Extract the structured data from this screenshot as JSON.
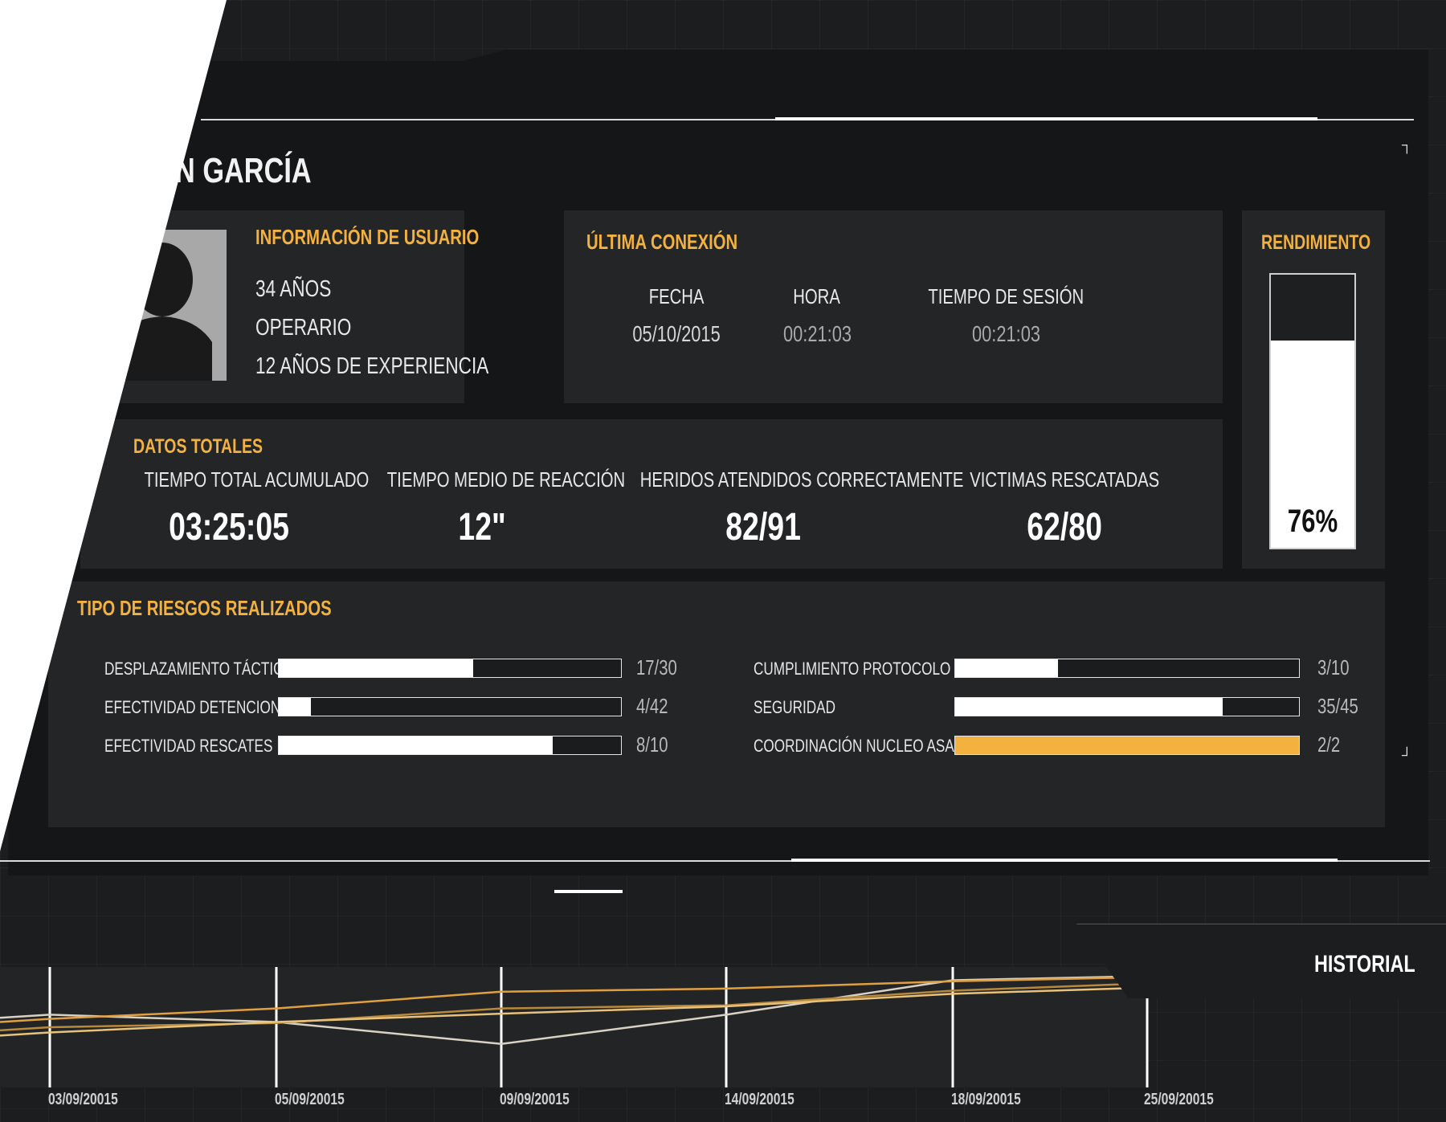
{
  "header": {
    "name": "N GARCÍA"
  },
  "user_info": {
    "title": "INFORMACIÓN DE USUARIO",
    "age": "34 AÑOS",
    "role": "OPERARIO",
    "experience": "12 AÑOS DE EXPERIENCIA"
  },
  "last_connection": {
    "title": "ÚLTIMA CONEXIÓN",
    "date_label": "FECHA",
    "date_value": "05/10/2015",
    "time_label": "HORA",
    "time_value": "00:21:03",
    "session_label": "TIEMPO DE SESIÓN",
    "session_value": "00:21:03"
  },
  "performance": {
    "title": "RENDIMIENTO",
    "value": "76%",
    "percent": 76
  },
  "totals": {
    "title": "DATOS TOTALES",
    "items": [
      {
        "label": "TIEMPO TOTAL ACUMULADO",
        "value": "03:25:05"
      },
      {
        "label": "TIEMPO MEDIO DE REACCIÓN",
        "value": "12\""
      },
      {
        "label": "HERIDOS ATENDIDOS CORRECTAMENTE",
        "value": "82/91"
      },
      {
        "label": "VICTIMAS RESCATADAS",
        "value": "62/80"
      }
    ]
  },
  "risks": {
    "title": "TIPO DE RIESGOS REALIZADOS",
    "left": [
      {
        "label": "DESPLAZAMIENTO TÁCTICO",
        "value": "17/30",
        "fraction": 0.567
      },
      {
        "label": "EFECTIVIDAD DETENCIONES",
        "value": "4/42",
        "fraction": 0.095
      },
      {
        "label": "EFECTIVIDAD RESCATES",
        "value": "8/10",
        "fraction": 0.8
      }
    ],
    "right": [
      {
        "label": "CUMPLIMIENTO PROTOCOLO",
        "value": "3/10",
        "fraction": 0.3
      },
      {
        "label": "SEGURIDAD",
        "value": "35/45",
        "fraction": 0.778
      },
      {
        "label": "COORDINACIÓN NUCLEO ASALTO",
        "value": "2/2",
        "fraction": 1.0
      }
    ]
  },
  "history": {
    "title": "HISTORIAL",
    "dates": [
      "03/09/20015",
      "05/09/20015",
      "09/09/20015",
      "14/09/20015",
      "18/09/20015",
      "25/09/20015"
    ]
  },
  "colors": {
    "accent": "#f3b23f",
    "panel": "#242527",
    "background": "#1c1d1f"
  },
  "chart_data": {
    "type": "line",
    "x": [
      "03/09/20015",
      "05/09/20015",
      "09/09/20015",
      "14/09/20015",
      "18/09/20015",
      "25/09/20015"
    ],
    "series": [
      {
        "values": [
          0.62,
          0.55,
          0.34,
          0.62,
          0.95,
          0.99
        ],
        "color": "#d9d2c4"
      },
      {
        "values": [
          0.58,
          0.68,
          0.84,
          0.87,
          0.94,
          0.98
        ],
        "color": "#e0a042"
      },
      {
        "values": [
          0.5,
          0.54,
          0.68,
          0.71,
          0.85,
          0.92
        ],
        "color": "#b8893c"
      },
      {
        "values": [
          0.45,
          0.55,
          0.63,
          0.7,
          0.82,
          0.88
        ],
        "color": "#e9c27a"
      }
    ],
    "ylim": [
      0,
      1
    ]
  }
}
